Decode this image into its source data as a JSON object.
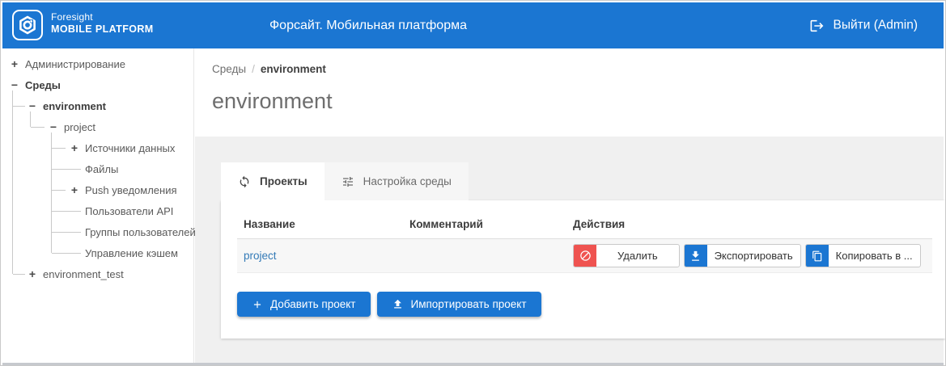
{
  "header": {
    "logo_line1": "Foresight",
    "logo_line2": "MOBILE PLATFORM",
    "title": "Форсайт. Мобильная платформа",
    "logout_label": "Выйти (Admin)"
  },
  "colors": {
    "header_blue": "#1b76d2",
    "accent_blue": "#1b76d2",
    "link_blue": "#337ab7",
    "danger_red": "#ef5350",
    "page_gray": "#f0f0f0"
  },
  "sidebar": {
    "tree": [
      {
        "label": "Администрирование",
        "toggle": "+"
      },
      {
        "label": "Среды",
        "toggle": "−"
      },
      {
        "label": "environment",
        "toggle": "−"
      },
      {
        "label": "project",
        "toggle": "−"
      },
      {
        "label": "Источники данных",
        "toggle": "+"
      },
      {
        "label": "Файлы",
        "toggle": ""
      },
      {
        "label": "Push уведомления",
        "toggle": "+"
      },
      {
        "label": "Пользователи API",
        "toggle": ""
      },
      {
        "label": "Группы пользователей",
        "toggle": ""
      },
      {
        "label": "Управление кэшем",
        "toggle": ""
      },
      {
        "label": "environment_test",
        "toggle": "+"
      }
    ]
  },
  "main": {
    "breadcrumb": {
      "parent": "Среды",
      "separator": "/",
      "current": "environment"
    },
    "page_title": "environment",
    "tabs": [
      {
        "label": "Проекты"
      },
      {
        "label": "Настройка среды"
      }
    ],
    "table": {
      "columns": [
        "Название",
        "Комментарий",
        "Действия"
      ],
      "rows": [
        {
          "name": "project",
          "comment": "",
          "actions": [
            "Удалить",
            "Экспортировать",
            "Копировать в ..."
          ]
        }
      ]
    },
    "footer_buttons": [
      {
        "label": "Добавить проект"
      },
      {
        "label": "Импортировать проект"
      }
    ]
  }
}
